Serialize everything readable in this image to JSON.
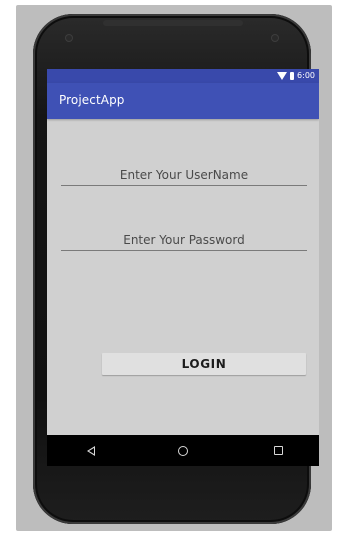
{
  "status_bar": {
    "time": "6:00",
    "icons": [
      "wifi-icon",
      "battery-icon"
    ]
  },
  "app_bar": {
    "title": "ProjectApp"
  },
  "form": {
    "username_placeholder": "Enter Your UserName",
    "password_placeholder": "Enter Your Password",
    "login_label": "LOGIN"
  },
  "nav_bar": {
    "icons": [
      "back-icon",
      "home-icon",
      "recent-apps-icon"
    ]
  },
  "colors": {
    "app_bar": "#3f51b5",
    "status_bar": "#3949ab",
    "screen_background": "#d0d0d0",
    "button_background": "#e0e0e0"
  }
}
